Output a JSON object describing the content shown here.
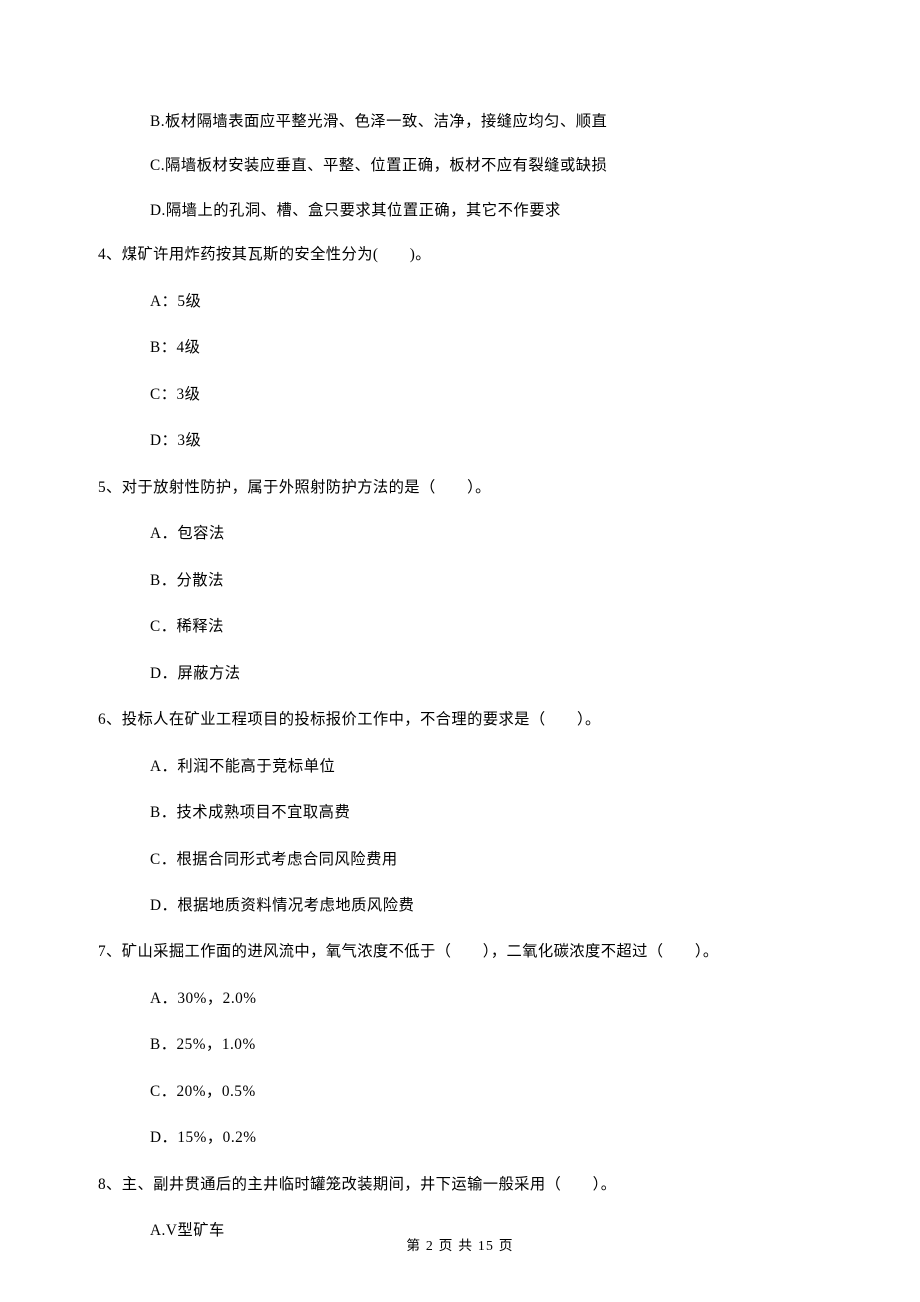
{
  "q3_opts_cont": {
    "b": "B.板材隔墙表面应平整光滑、色泽一致、洁净，接缝应均匀、顺直",
    "c": "C.隔墙板材安装应垂直、平整、位置正确，板材不应有裂缝或缺损",
    "d": "D.隔墙上的孔洞、槽、盒只要求其位置正确，其它不作要求"
  },
  "q4": {
    "stem": "4、煤矿许用炸药按其瓦斯的安全性分为(　　)。",
    "a": "A：5级",
    "b": "B：4级",
    "c": "C：3级",
    "d": "D：3级"
  },
  "q5": {
    "stem": "5、对于放射性防护，属于外照射防护方法的是（　　）。",
    "a": "A．包容法",
    "b": "B．分散法",
    "c": "C．稀释法",
    "d": "D．屏蔽方法"
  },
  "q6": {
    "stem": "6、投标人在矿业工程项目的投标报价工作中，不合理的要求是（　　）。",
    "a": "A．利润不能高于竞标单位",
    "b": "B．技术成熟项目不宜取高费",
    "c": "C．根据合同形式考虑合同风险费用",
    "d": "D．根据地质资料情况考虑地质风险费"
  },
  "q7": {
    "stem": "7、矿山采掘工作面的进风流中，氧气浓度不低于（　　），二氧化碳浓度不超过（　　）。",
    "a": "A．30%，2.0%",
    "b": "B．25%，1.0%",
    "c": "C．20%，0.5%",
    "d": "D．15%，0.2%"
  },
  "q8": {
    "stem": "8、主、副井贯通后的主井临时罐笼改装期间，井下运输一般采用（　　）。",
    "a": "A.V型矿车"
  },
  "footer": "第 2 页 共 15 页"
}
